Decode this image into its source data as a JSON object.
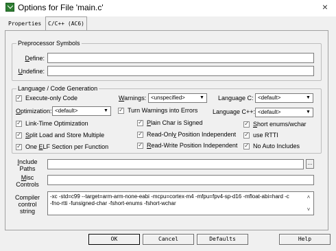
{
  "window": {
    "title": "Options for File 'main.c'",
    "close_glyph": "×"
  },
  "tabs": [
    {
      "label": "Properties"
    },
    {
      "label": "C/C++ (AC6)"
    }
  ],
  "preprocessor": {
    "group_title": "Preprocessor Symbols",
    "define_label_u": "D",
    "define_label_rest": "efine:",
    "define_value": "",
    "undefine_label_u": "U",
    "undefine_label_rest": "ndefine:",
    "undefine_value": ""
  },
  "codegen": {
    "group_title": "Language / Code Generation",
    "execute_only": {
      "label": "Execute-only Code",
      "checked": true
    },
    "warnings": {
      "label_u": "W",
      "label_rest": "arnings:",
      "value": "<unspecified>"
    },
    "language_c": {
      "label": "Language C:",
      "value": "<default>"
    },
    "optimization": {
      "label_u": "O",
      "label_rest": "ptimization:",
      "value": "<default>"
    },
    "turn_warnings_errors": {
      "label": "Turn Warnings into Errors",
      "checked": true
    },
    "language_cpp": {
      "label": "Language C++:",
      "value": "<default>"
    },
    "lto": {
      "label": "Link-Time Optimization",
      "checked": true
    },
    "plain_char": {
      "label_u": "P",
      "label_rest": "lain Char is Signed",
      "checked": true
    },
    "short_enums": {
      "label_u": "S",
      "label_rest": "hort enums/wchar",
      "checked": true
    },
    "split_load": {
      "label_u": "S",
      "label_rest": "plit Load and Store Multiple",
      "checked": true
    },
    "ro_pi": {
      "label_pre": "Read-Onl",
      "label_u": "y",
      "label_rest": " Position Independent",
      "checked": true
    },
    "rtti": {
      "label": "use RTTI",
      "checked": true
    },
    "one_elf": {
      "label_pre": "One ",
      "label_u": "E",
      "label_rest": "LF Section per Function",
      "checked": true
    },
    "rw_pi": {
      "label_u": "R",
      "label_rest": "ead-Write Position Independent",
      "checked": true
    },
    "no_auto_includes": {
      "label": "No Auto Includes",
      "checked": true
    }
  },
  "include": {
    "label_u": "I",
    "label_rest": "nclude",
    "label_line2": "Paths",
    "value": "",
    "browse": "..."
  },
  "misc": {
    "label_u": "M",
    "label_rest": "isc",
    "label_line2": "Controls",
    "value": ""
  },
  "compiler": {
    "label_line1": "Compiler",
    "label_line2": "control",
    "label_line3": "string",
    "line1": "-xc -std=c99 --target=arm-arm-none-eabi -mcpu=cortex-m4 -mfpu=fpv4-sp-d16 -mfloat-abi=hard -c",
    "line2": "-fno-rtti -funsigned-char -fshort-enums -fshort-wchar"
  },
  "buttons": {
    "ok": "OK",
    "cancel": "Cancel",
    "defaults": "Defaults",
    "help": "Help"
  },
  "icons": {
    "dropdown": "▼",
    "scroll_up": "˄",
    "scroll_down": "˅"
  }
}
